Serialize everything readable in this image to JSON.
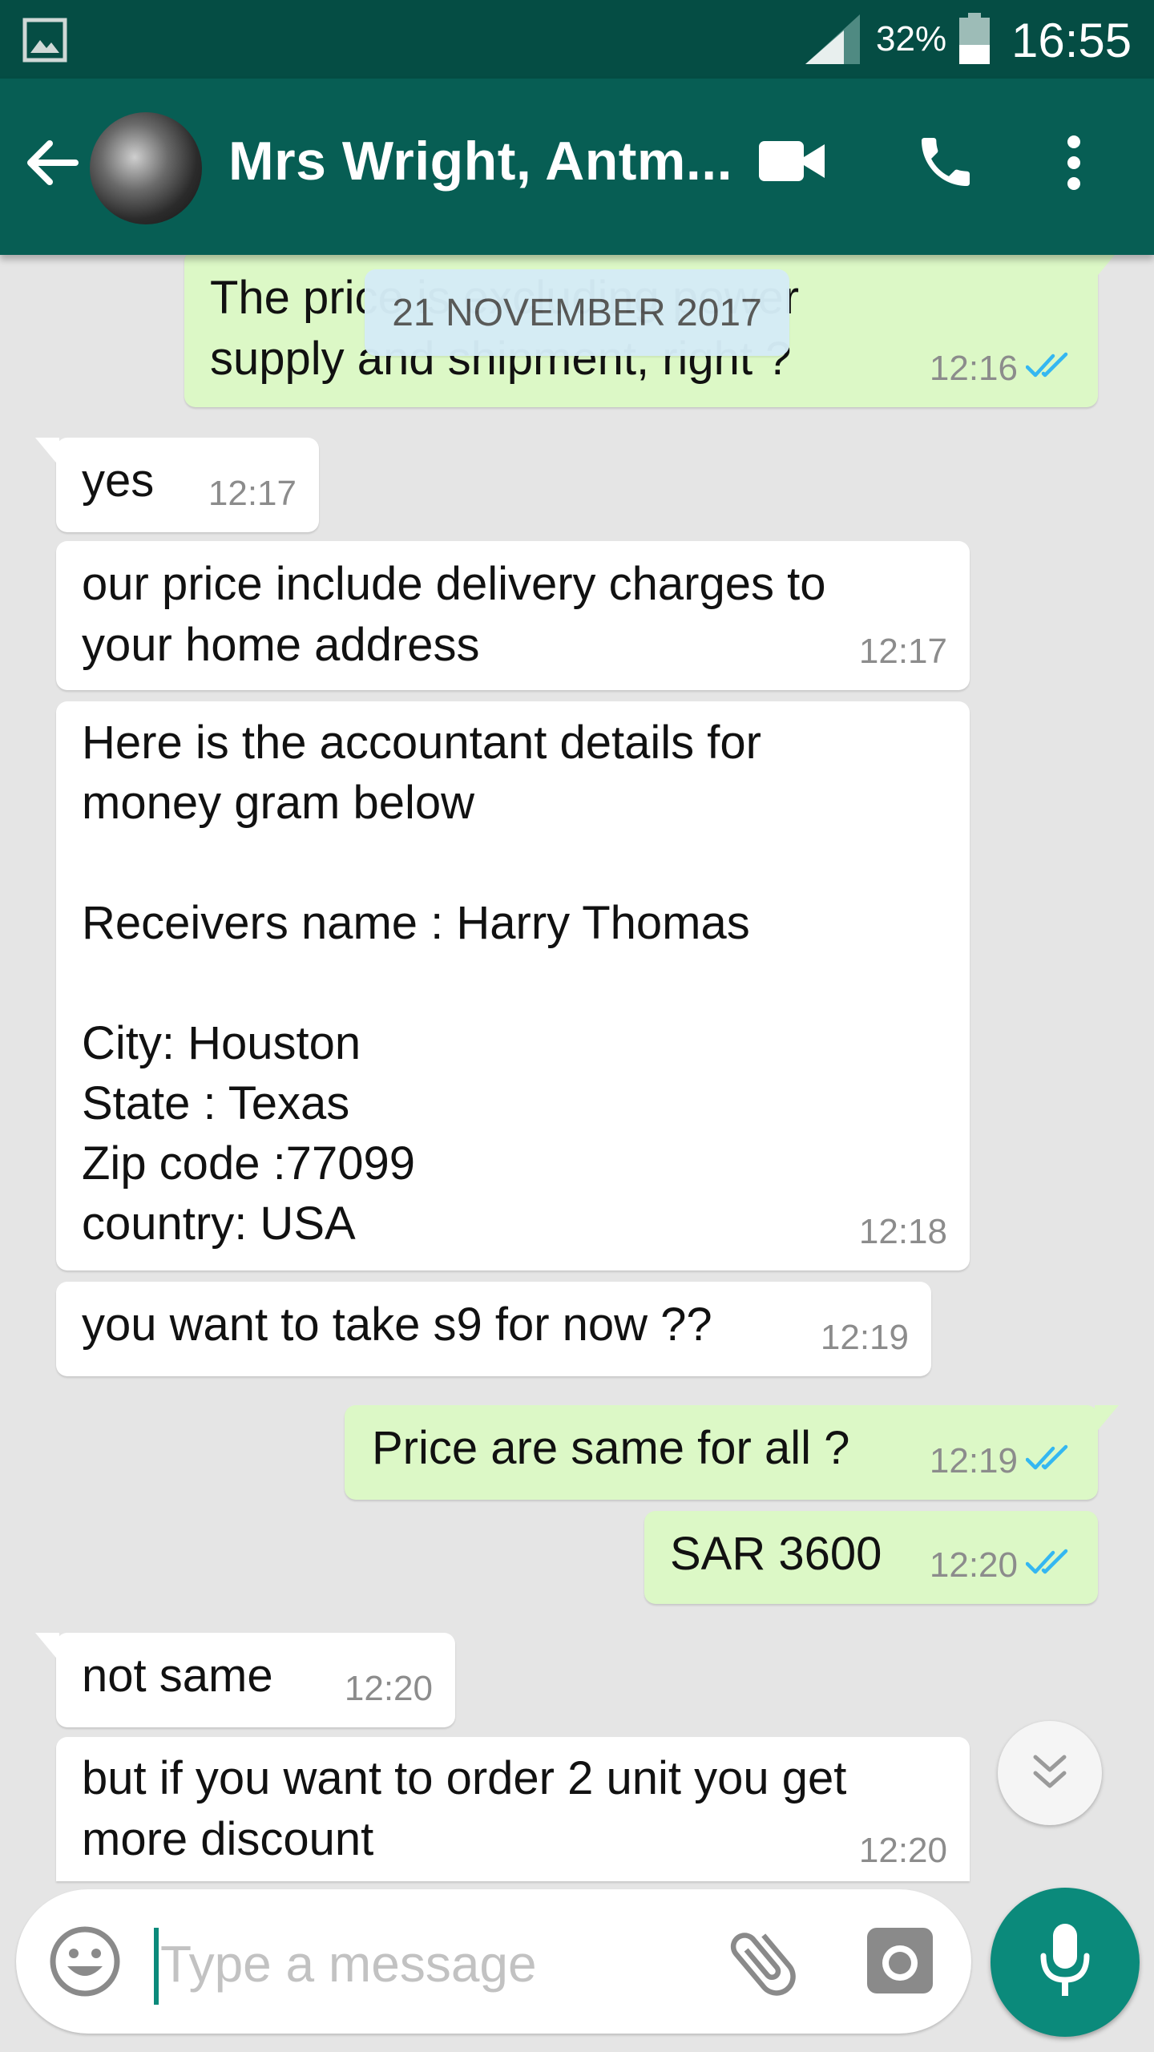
{
  "status_bar": {
    "battery": "32%",
    "time": "16:55"
  },
  "header": {
    "title": "Mrs Wright, Antm..."
  },
  "date_chip": "21 NOVEMBER 2017",
  "messages": [
    {
      "dir": "out",
      "text": "The price is excluding power\nsupply and shipment, right ?",
      "time": "12:16",
      "read": true
    },
    {
      "dir": "in",
      "text": "yes",
      "time": "12:17"
    },
    {
      "dir": "in",
      "text": "our price include delivery charges to\nyour home address",
      "time": "12:17"
    },
    {
      "dir": "in",
      "text": "Here is the accountant details for\nmoney gram below\n\nReceivers name : Harry Thomas\n\nCity: Houston\nState : Texas\nZip code :77099\ncountry: USA",
      "time": "12:18"
    },
    {
      "dir": "in",
      "text": "you want to take s9 for now ??",
      "time": "12:19"
    },
    {
      "dir": "out",
      "text": "Price are same for all ?",
      "time": "12:19",
      "read": true
    },
    {
      "dir": "out",
      "text": "SAR 3600",
      "time": "12:20",
      "read": true
    },
    {
      "dir": "in",
      "text": "not same",
      "time": "12:20"
    },
    {
      "dir": "in",
      "text": "but if you want to order 2 unit you get\nmore discount",
      "time": "12:20"
    }
  ],
  "compose": {
    "placeholder": "Type a message"
  },
  "colors": {
    "header": "#075e54",
    "status_bar": "#054d44",
    "background": "#e5e5e5",
    "incoming_bubble": "#ffffff",
    "outgoing_bubble": "#dcf8c6",
    "read_ticks": "#34b7f1",
    "accent": "#0b8a7b"
  }
}
